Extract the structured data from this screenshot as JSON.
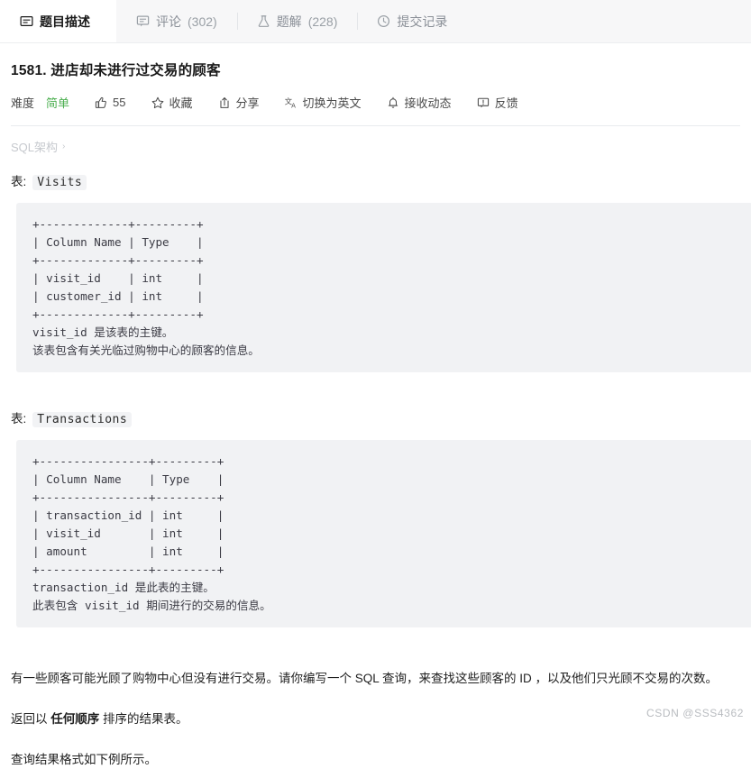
{
  "tabs": [
    {
      "label": "题目描述",
      "count": "",
      "icon": "description-icon",
      "active": true
    },
    {
      "label": "评论",
      "count": "(302)",
      "icon": "comment-icon",
      "active": false
    },
    {
      "label": "题解",
      "count": "(228)",
      "icon": "flask-icon",
      "active": false
    },
    {
      "label": "提交记录",
      "count": "",
      "icon": "clock-icon",
      "active": false
    }
  ],
  "problem": {
    "title": "1581. 进店却未进行过交易的顾客"
  },
  "actions": {
    "difficulty_label": "难度",
    "difficulty_value": "简单",
    "difficulty_color": "#4caf50",
    "like_count": "55",
    "favorite_label": "收藏",
    "share_label": "分享",
    "translate_label": "切换为英文",
    "subscribe_label": "接收动态",
    "feedback_label": "反馈"
  },
  "breadcrumb": {
    "label": "SQL架构",
    "chevron": "›"
  },
  "sections": [
    {
      "label_prefix": "表:",
      "table_name": "Visits",
      "code": "+-------------+---------+\n| Column Name | Type    |\n+-------------+---------+\n| visit_id    | int     |\n| customer_id | int     |\n+-------------+---------+\nvisit_id 是该表的主键。\n该表包含有关光临过购物中心的顾客的信息。"
    },
    {
      "label_prefix": "表:",
      "table_name": "Transactions",
      "code": "+----------------+---------+\n| Column Name    | Type    |\n+----------------+---------+\n| transaction_id | int     |\n| visit_id       | int     |\n| amount         | int     |\n+----------------+---------+\ntransaction_id 是此表的主键。\n此表包含 visit_id 期间进行的交易的信息。"
    }
  ],
  "body": {
    "p1": "有一些顾客可能光顾了购物中心但没有进行交易。请你编写一个 SQL 查询，来查找这些顾客的 ID ，以及他们只光顾不交易的次数。",
    "p2_prefix": "返回以 ",
    "p2_bold": "任何顺序",
    "p2_suffix": " 排序的结果表。",
    "p3": "查询结果格式如下例所示。"
  },
  "watermark": "CSDN @SSS4362"
}
